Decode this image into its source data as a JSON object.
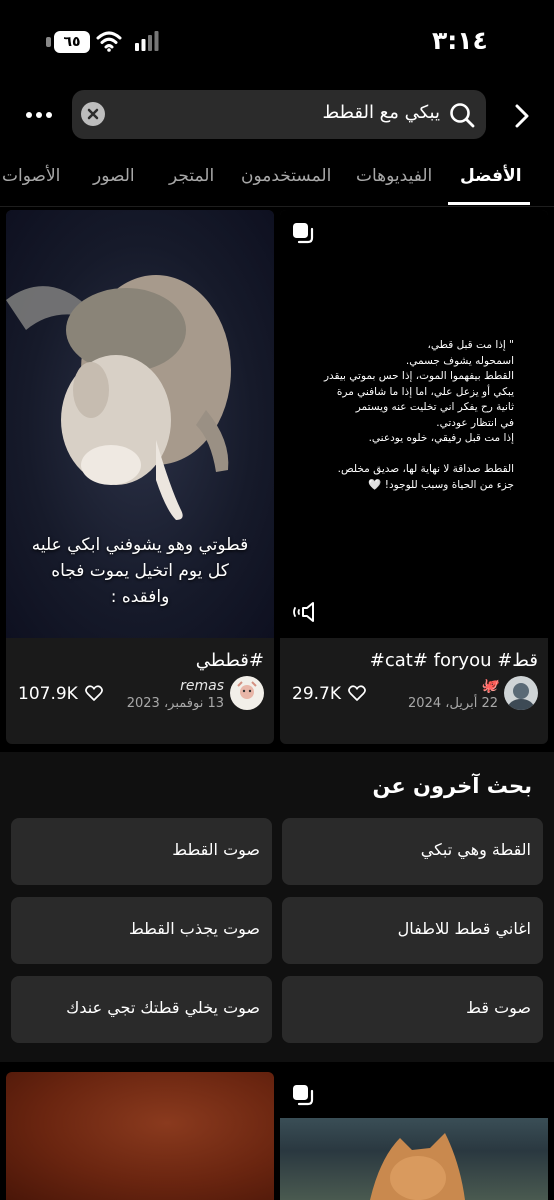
{
  "status_bar": {
    "time": "٣:١٤",
    "battery_level": "٦٥"
  },
  "search": {
    "query": "يبكي مع القطط"
  },
  "tabs": [
    "الأفضل",
    "الفيديوهات",
    "المستخدمون",
    "المتجر",
    "الصور",
    "الأصوات"
  ],
  "active_tab": "الأفضل",
  "results": [
    {
      "overlay_text": "\" إذا مت قبل قطي،\nاسمحوله يشوف جسمي.\nالقطط بيفهموا الموت، إذا حس بموتي بيقدر\nيبكي أو يزعل علي، اما إذا ما شافني مرة\nثانية  رح يفكر اني تخليت عنه ويستمر\nفي انتظار عودتي.\nإذا مت قبل رفيقي، خلوه يودعني.\n\nالقطط صداقة لا نهاية لها، صديق مخلص.\nجزء من الحياة وسبب للوجود! 🤍",
      "title": "قط# cat# foryou#",
      "author_name": "🐙",
      "date": "22 أبريل، 2024",
      "likes": "29.7K"
    },
    {
      "overlay_text": "قطوتي وهو يشوفني ابكي عليه\nكل يوم اتخيل يموت فجاه\nوافقده :",
      "title": "#قططي",
      "author_name": "remas",
      "date": "13 نوفمبر، 2023",
      "likes": "107.9K"
    }
  ],
  "others_searched": {
    "title": "بحث آخرون عن",
    "items": [
      "القطة وهي تبكي",
      "صوت القطط",
      "اغاني قطط للاطفال",
      "صوت يجذب القطط",
      "صوت قط",
      "صوت يخلي قطتك تجي عندك"
    ]
  }
}
